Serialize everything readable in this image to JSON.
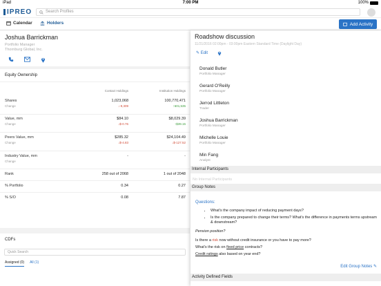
{
  "status": {
    "left": "iPad",
    "time": "7:00 PM",
    "battery": "100%"
  },
  "header": {
    "logo": "IPREO",
    "search_placeholder": "Search Profiles"
  },
  "toolbar": {
    "calendar": "Calendar",
    "holders": "Holders",
    "add_activity": "Add Activity"
  },
  "profile": {
    "name": "Joshua Barrickman",
    "title": "Portfolio Manager",
    "company": "Thornburg Global, Inc."
  },
  "equity": {
    "title": "Equity Ownership",
    "col1": "Contact Holdings",
    "col2": "Institution Holdings",
    "rows": [
      {
        "label": "Shares",
        "sub": "Change",
        "v1": "1,023,068",
        "c1": "-9,309",
        "v2": "100,770,471",
        "c2": "601,535",
        "c2dir": "up"
      },
      {
        "label": "Value, mm",
        "sub": "Change",
        "v1": "$84.10",
        "c1": "$-0.76",
        "v2": "$8,029.39",
        "c2": "$39.15",
        "c2dir": "up"
      },
      {
        "label": "Peers Value, mm",
        "sub": "Change",
        "v1": "$285.32",
        "c1": "$-4.83",
        "v2": "$24,104.49",
        "c2": "$-127.52",
        "c2dir": "down"
      },
      {
        "label": "Industry Value, mm",
        "sub": "Change",
        "v1": "-",
        "c1": "",
        "v2": "-",
        "c2": "",
        "c2dir": "down"
      },
      {
        "label": "Rank",
        "sub": "",
        "v1": "258 out of 2068",
        "c1": "",
        "v2": "1 out of 2048",
        "c2": "",
        "c2dir": "down"
      },
      {
        "label": "% Portfolio",
        "sub": "",
        "v1": "0.34",
        "c1": "",
        "v2": "0.27",
        "c2": "",
        "c2dir": "down"
      },
      {
        "label": "% S/O",
        "sub": "",
        "v1": "0.08",
        "c1": "",
        "v2": "7.87",
        "c2": "",
        "c2dir": "down"
      }
    ]
  },
  "cdfs": {
    "title": "CDFs",
    "search_placeholder": "Quick Search",
    "tab_assigned": "Assigned (0)",
    "tab_all": "All (1)"
  },
  "roadshow": {
    "title": "Roadshow discussion",
    "subtitle": "11/21/2016 02:00pm - 03:00pm Eastern Standard Time (Daylight Day)",
    "edit": "Edit",
    "participants": [
      {
        "name": "Donald Butler",
        "role": "Portfolio Manager"
      },
      {
        "name": "Gerard O'Reilly",
        "role": "Portfolio Manager"
      },
      {
        "name": "Jerrod Littleton",
        "role": "Trader"
      },
      {
        "name": "Joshua Barrickman",
        "role": "Portfolio Manager"
      },
      {
        "name": "Michelle Louie",
        "role": "Portfolio Manager"
      },
      {
        "name": "Min Fang",
        "role": "Analyst"
      }
    ],
    "internal_header": "Internal Participants",
    "no_internal": "No Internal Participants",
    "group_notes_header": "Group Notes",
    "questions": "Questions:",
    "q1": "What's the company impact of reducing payment days?",
    "q2": "Is the company prepared to change their terms? What's the difference in payments terms upstream & downstream?",
    "pension": "Pension position?",
    "p1a": "Is there a ",
    "p1b": "risk",
    "p1c": " now without credit insurance or you have to pay more?",
    "p2a": "What's the risk on ",
    "p2b": "fixed price",
    "p2c": " contracts?",
    "p3a": "Credit ratings",
    "p3b": " also based on year end?",
    "edit_notes": "Edit Group Notes",
    "activity_fields": "Activity Defined Fields"
  }
}
